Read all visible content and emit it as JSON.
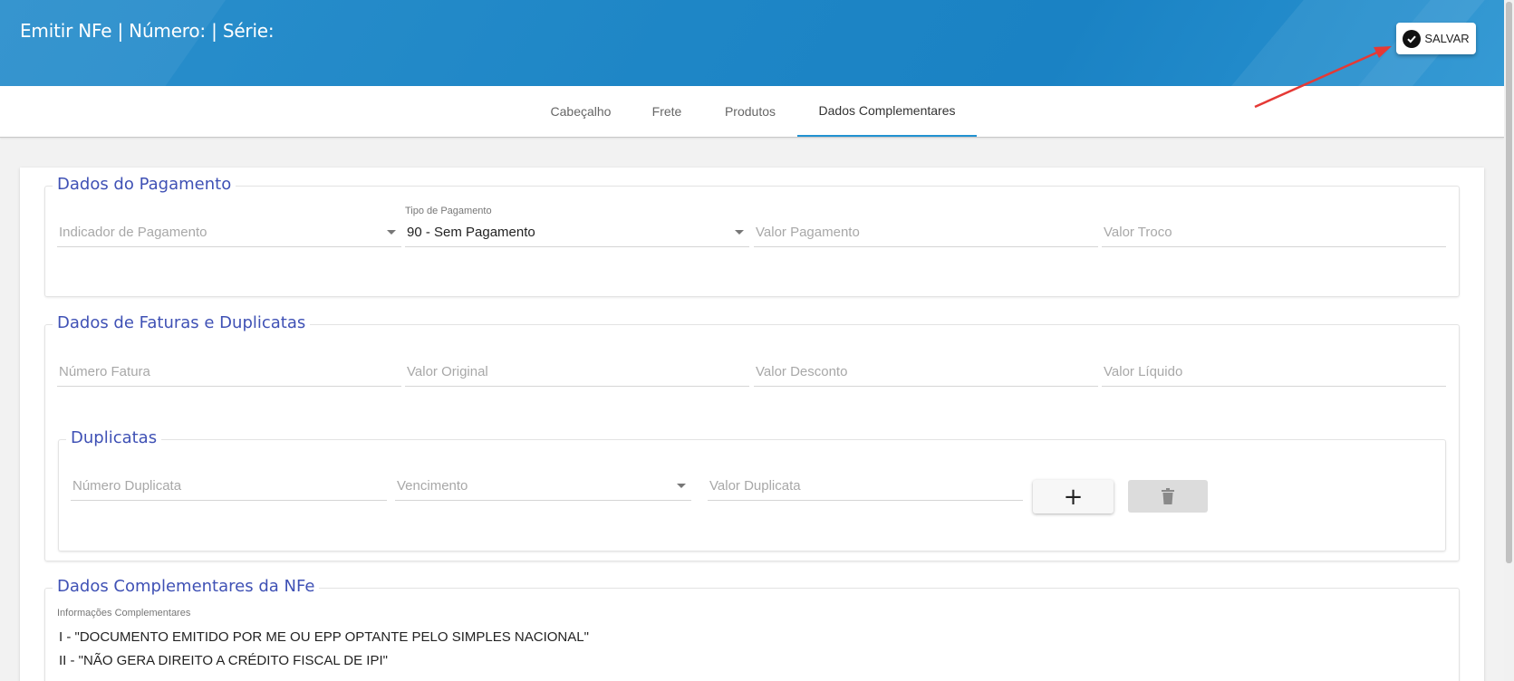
{
  "header": {
    "title": "Emitir NFe | Número: | Série:",
    "save_label": "SALVAR"
  },
  "tabs": [
    {
      "label": "Cabeçalho"
    },
    {
      "label": "Frete"
    },
    {
      "label": "Produtos"
    },
    {
      "label": "Dados Complementares"
    }
  ],
  "active_tab": "Dados Complementares",
  "pagamento": {
    "legend": "Dados do Pagamento",
    "indicador_placeholder": "Indicador de Pagamento",
    "tipo_label": "Tipo de Pagamento",
    "tipo_value": "90 - Sem Pagamento",
    "valor_pagamento_placeholder": "Valor Pagamento",
    "valor_troco_placeholder": "Valor Troco"
  },
  "faturas": {
    "legend": "Dados de Faturas e Duplicatas",
    "numero_fatura_placeholder": "Número Fatura",
    "valor_original_placeholder": "Valor Original",
    "valor_desconto_placeholder": "Valor Desconto",
    "valor_liquido_placeholder": "Valor Líquido"
  },
  "duplicatas": {
    "legend": "Duplicatas",
    "numero_placeholder": "Número Duplicata",
    "vencimento_placeholder": "Vencimento",
    "valor_placeholder": "Valor Duplicata",
    "add_label": "+"
  },
  "complementares": {
    "legend": "Dados Complementares da NFe",
    "info_label": "Informações Complementares",
    "lines": [
      "I - \"DOCUMENTO EMITIDO POR ME OU EPP OPTANTE PELO SIMPLES NACIONAL\"",
      "II - \"NÃO GERA DIREITO A CRÉDITO FISCAL DE IPI\""
    ]
  },
  "colors": {
    "header": "#1e86c6",
    "accent": "#2192d1",
    "legend": "#3f51b5",
    "annotation": "#e53935"
  },
  "icons": [
    "check-circle-icon",
    "plus-icon",
    "trash-icon",
    "dropdown-caret-icon",
    "annotation-arrow"
  ]
}
